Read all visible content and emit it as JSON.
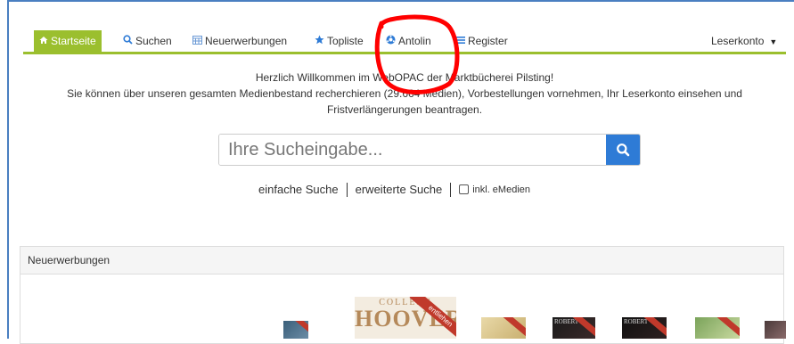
{
  "navbar": {
    "items": [
      {
        "label": "Startseite",
        "icon": "home-icon",
        "active": true
      },
      {
        "label": "Suchen",
        "icon": "search-icon"
      },
      {
        "label": "Neuerwerbungen",
        "icon": "calendar-icon"
      },
      {
        "label": "Topliste",
        "icon": "star-icon"
      },
      {
        "label": "Antolin",
        "icon": "antolin-icon"
      },
      {
        "label": "Register",
        "icon": "list-icon"
      }
    ],
    "account_label": "Leserkonto",
    "accent_color": "#9bbf2e"
  },
  "welcome": {
    "line1": "Herzlich Willkommen im WebOPAC der Marktbücherei Pilsting!",
    "line2": "Sie können über unseren gesamten Medienbestand recherchieren (29.664 Medien), Vorbestellungen vornehmen, Ihr Leserkonto einsehen und",
    "line3": "Fristverlängerungen beantragen."
  },
  "search": {
    "placeholder": "Ihre Sucheingabe...",
    "button_color": "#2e7bd6"
  },
  "search_links": {
    "simple": "einfache Suche",
    "advanced": "erweiterte Suche",
    "emedia_checkbox": "inkl. eMedien",
    "emedia_checked": false
  },
  "panel": {
    "title": "Neuerwerbungen",
    "featured_cover_text": "COLLEEN HOOVER",
    "featured_ribbon": "entliehen"
  },
  "annotation_color": "#ff0000"
}
